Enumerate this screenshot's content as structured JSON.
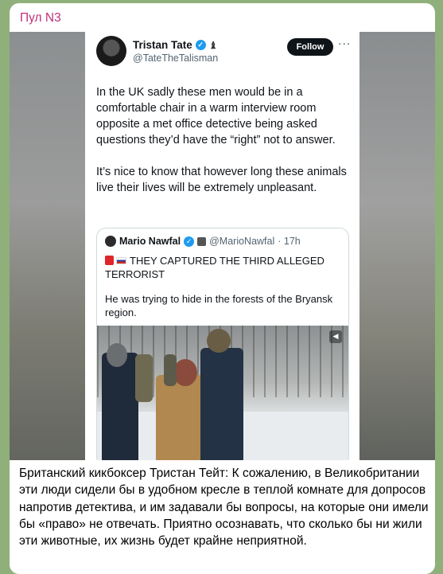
{
  "channel": {
    "name": "Пул N3"
  },
  "tweet": {
    "author_name": "Tristan Tate",
    "handle": "@TateTheTalisman",
    "follow_label": "Follow",
    "more_glyph": "···",
    "chess_glyph": "♝",
    "paragraphs": [
      "In the UK sadly these men would be in a comfortable chair in a warm interview room opposite a met office detective being asked questions they’d have the “right” not to answer.",
      "It’s nice to know that however long these animals live their lives will be extremely unpleasant."
    ]
  },
  "quote": {
    "author_name": "Mario Nawfal",
    "handle": "@MarioNawfal",
    "time": "· 17h",
    "headline": "THEY CAPTURED THE THIRD ALLEGED TERRORIST",
    "body": "He was trying to hide in the forests of the Bryansk region."
  },
  "caption": "Британский кикбоксер Тристан Тейт: К сожалению, в Великобритании эти люди сидели бы в удобном кресле в теплой комнате для допросов напротив детектива, и им задавали бы вопросы, на которые они имели бы «право» не отвечать. Приятно осознавать, что сколько бы ни жили эти животные, их жизнь будет крайне неприятной.",
  "colors": {
    "channel_name": "#c0317b",
    "follow_button": "#0f1419",
    "verified": "#1d9bf0"
  }
}
